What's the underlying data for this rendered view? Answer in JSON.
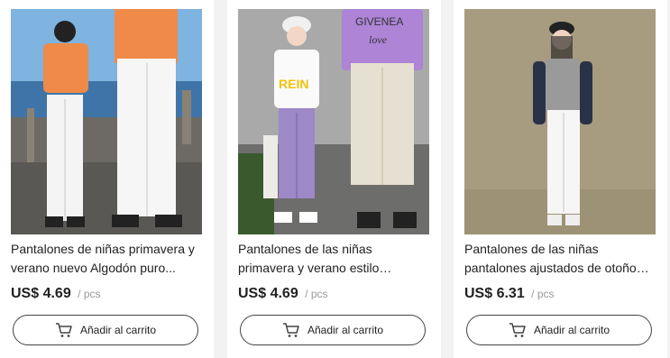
{
  "products": [
    {
      "title": "Pantalones de niñas primavera y verano nuevo Algodón puro...",
      "price": "US$ 4.69",
      "unit": "/ pcs",
      "cart_label": "Añadir al carrito"
    },
    {
      "title": "Pantalones de las niñas primavera y verano estilo corean...",
      "price": "US$ 4.69",
      "unit": "/ pcs",
      "cart_label": "Añadir al carrito"
    },
    {
      "title": "Pantalones de las niñas pantalones ajustados de otoño e...",
      "price": "US$ 6.31",
      "unit": "/ pcs",
      "cart_label": "Añadir al carrito"
    }
  ],
  "images": [
    {
      "shirt_print": ""
    },
    {
      "shirt_print_1": "REIN",
      "shirt_print_2": "GIVENEA",
      "shirt_print_3": "love"
    },
    {}
  ]
}
